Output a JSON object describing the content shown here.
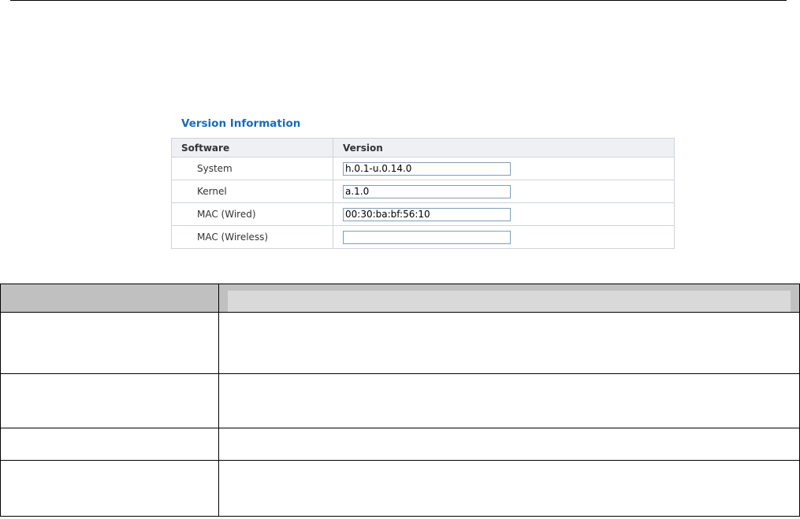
{
  "panel": {
    "title": "Version Information",
    "columns": {
      "software": "Software",
      "version": "Version"
    },
    "rows": [
      {
        "software": "System",
        "version": "h.0.1-u.0.14.0"
      },
      {
        "software": "Kernel",
        "version": "a.1.0"
      },
      {
        "software": "MAC (Wired)",
        "version": "00:30:ba:bf:56:10"
      },
      {
        "software": "MAC (Wireless)",
        "version": ""
      }
    ]
  },
  "colors": {
    "title": "#1a6bb5",
    "table_header_bg": "#eef0f4",
    "table_border": "#cfd3d8",
    "input_border": "#7f9db9",
    "desc_header_bg": "#c0c0c0"
  }
}
